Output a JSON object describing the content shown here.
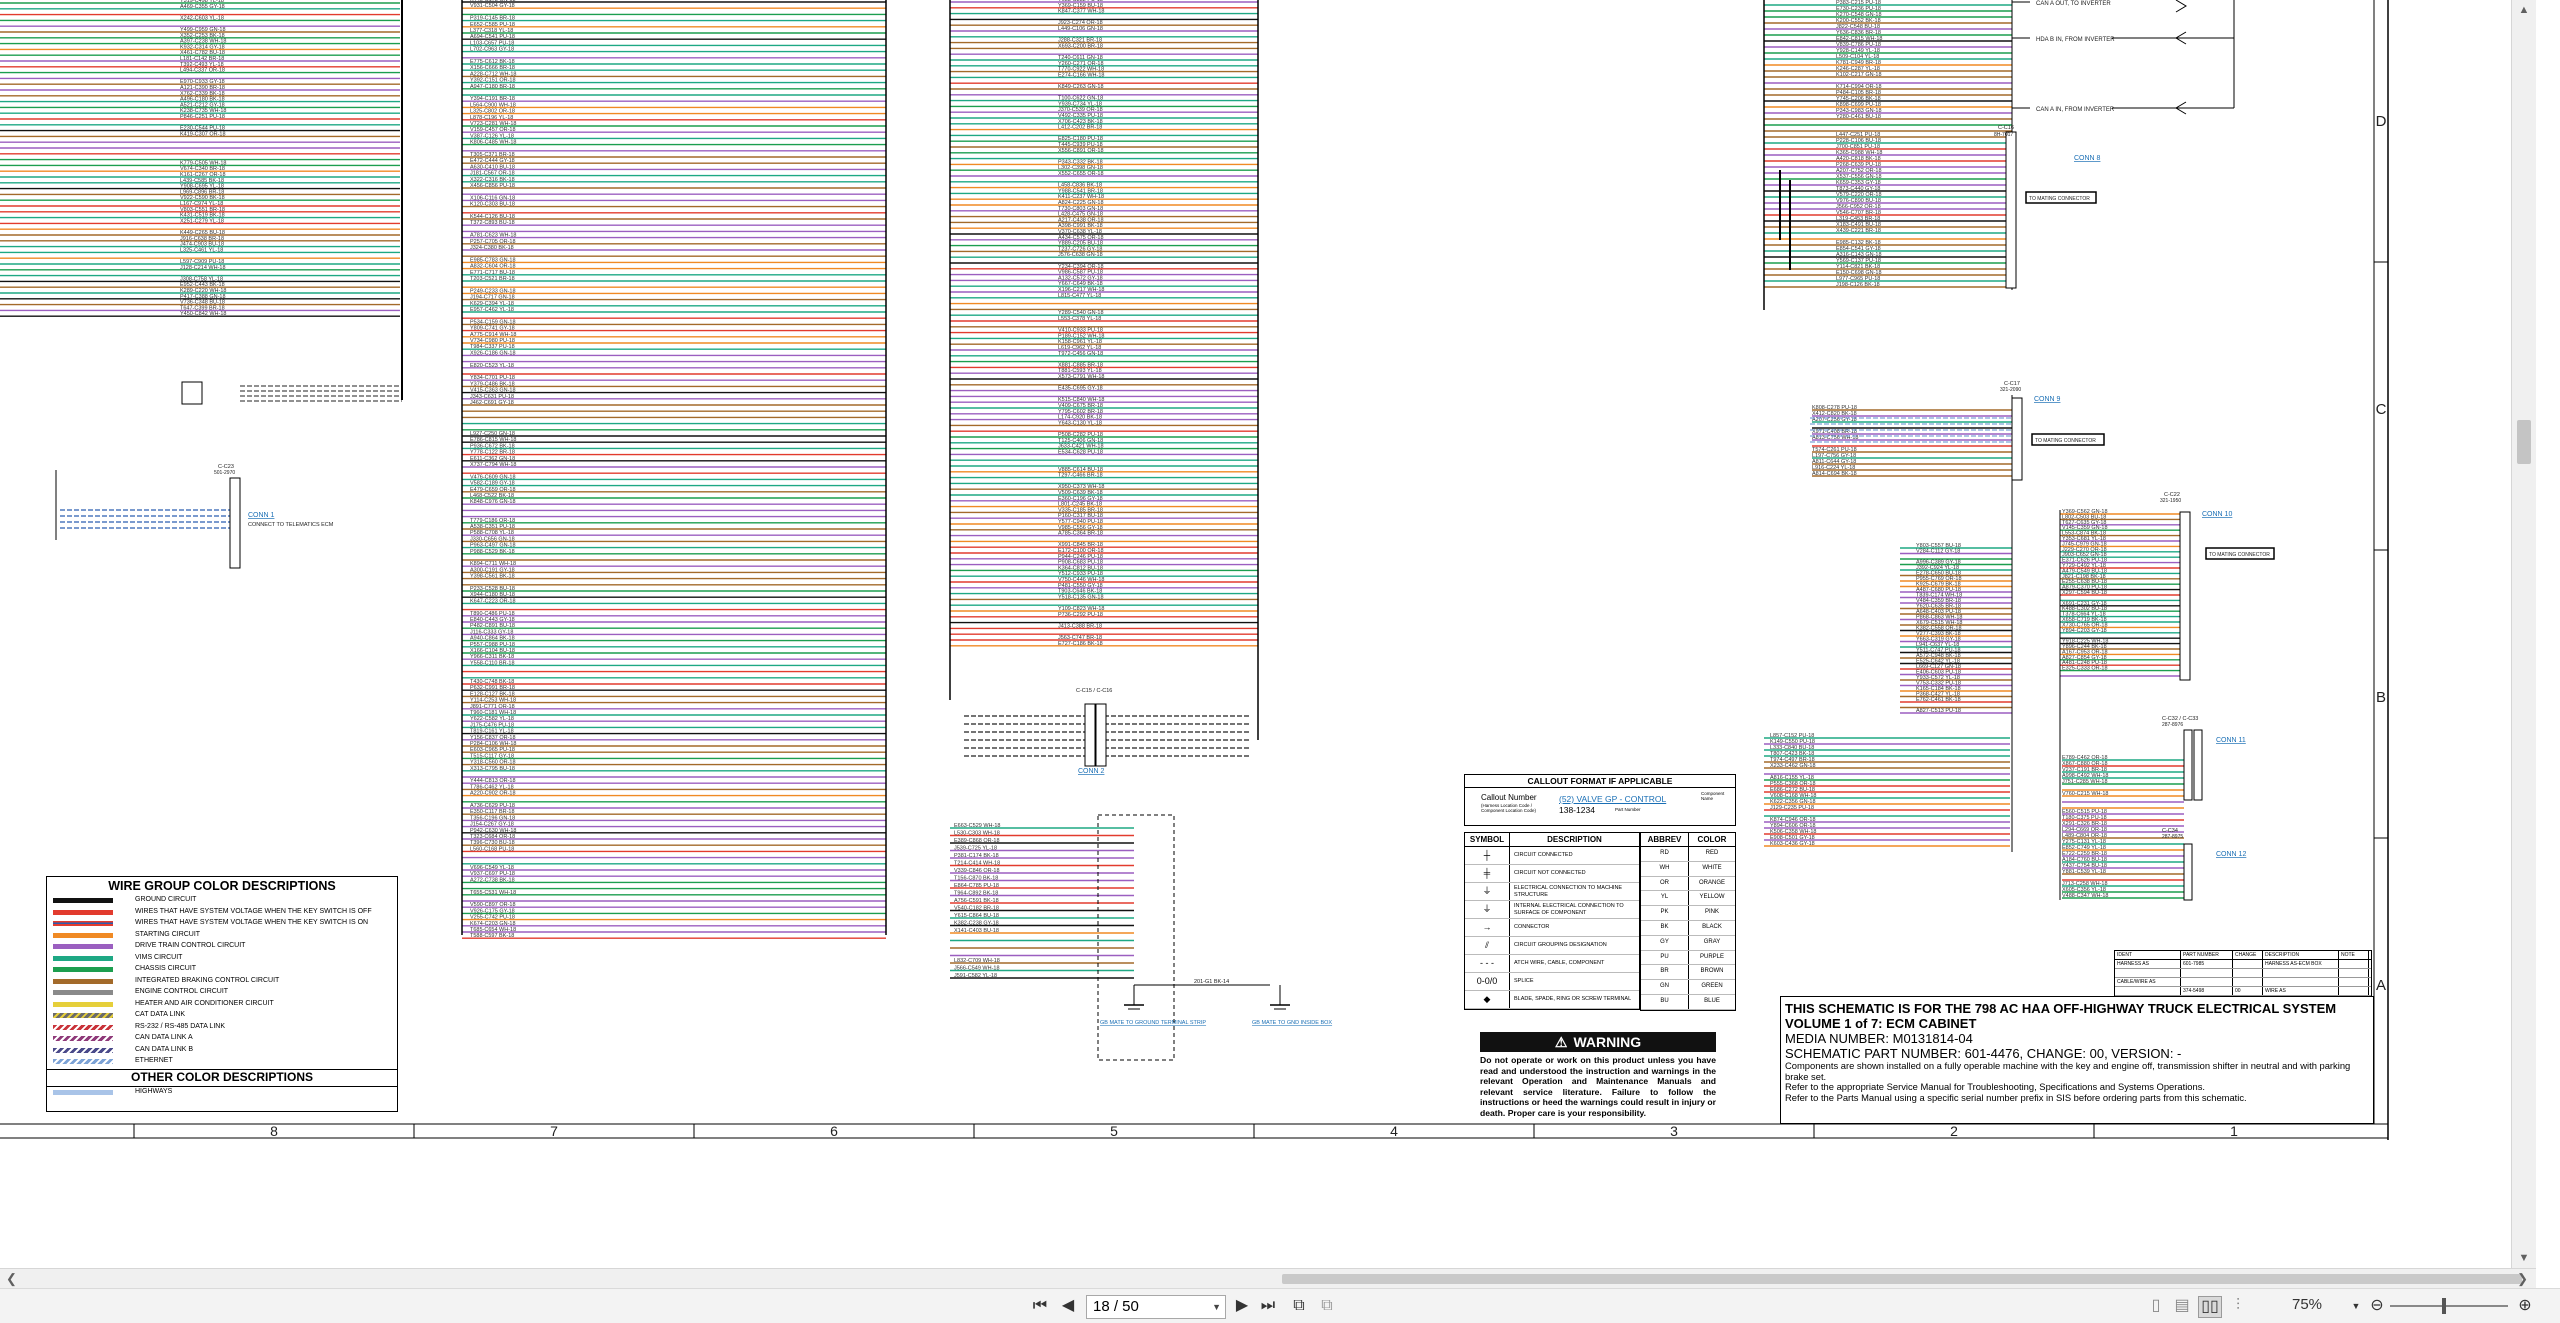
{
  "sheet": {
    "zone_letters": [
      "D",
      "C",
      "B",
      "A"
    ],
    "column_numbers": [
      "8",
      "7",
      "6",
      "5",
      "4",
      "3",
      "2",
      "1"
    ],
    "connectors": {
      "conn1": {
        "label": "CONN 1",
        "desc": "CONNECT TO TELEMATICS ECM",
        "id": "C-C23",
        "part": "501-2970"
      },
      "conn2": {
        "label": "CONN 2",
        "id": "C-C15 / C-C16"
      },
      "conn8": {
        "label": "CONN 8",
        "id": "C-C16",
        "part": "8H-7017",
        "mating": "TO MATING CONNECTOR"
      },
      "conn9": {
        "label": "CONN 9",
        "id": "C-C17",
        "part": "321-2090",
        "mating": "TO MATING CONNECTOR"
      },
      "conn10": {
        "label": "CONN 10",
        "id": "C-C22",
        "part": "321-1950",
        "mating": "TO MATING CONNECTOR"
      },
      "conn11": {
        "label": "CONN 11",
        "id": "C-C32 / C-C33",
        "part": "287-8976"
      },
      "conn12": {
        "label": "CONN 12",
        "id": "C-C34",
        "part": "287-8975"
      }
    },
    "inverter_labels": [
      "CAN A OUT, TO INVERTER",
      "HDA B IN, FROM INVERTER",
      "CAN A IN, FROM INVERTER"
    ],
    "ground_labels": [
      "GB MATE TO GROUND TERMINAL STRIP",
      "GB MATE TO GND INSIDE BOX"
    ],
    "ground_wire": "201-G1 BK-14",
    "wire_group_legend": {
      "title": "WIRE GROUP COLOR DESCRIPTIONS",
      "items": [
        {
          "label": "GROUND CIRCUIT",
          "color": "#111111",
          "pattern": "solid"
        },
        {
          "label": "WIRES THAT HAVE SYSTEM VOLTAGE WHEN THE KEY SWITCH IS OFF",
          "color": "#e23b2e",
          "pattern": "solid"
        },
        {
          "label": "WIRES THAT HAVE SYSTEM VOLTAGE WHEN THE KEY SWITCH IS ON",
          "color": "#e23b2e",
          "pattern": "blue-stripe"
        },
        {
          "label": "STARTING CIRCUIT",
          "color": "#f08a24",
          "pattern": "solid"
        },
        {
          "label": "DRIVE TRAIN CONTROL CIRCUIT",
          "color": "#9b5fc0",
          "pattern": "solid"
        },
        {
          "label": "VIMS CIRCUIT",
          "color": "#1ea884",
          "pattern": "solid"
        },
        {
          "label": "CHASSIS CIRCUIT",
          "color": "#1c9e4f",
          "pattern": "solid"
        },
        {
          "label": "INTEGRATED BRAKING CONTROL CIRCUIT",
          "color": "#a36a2a",
          "pattern": "solid"
        },
        {
          "label": "ENGINE CONTROL CIRCUIT",
          "color": "#8a8a8a",
          "pattern": "solid"
        },
        {
          "label": "HEATER AND AIR CONDITIONER CIRCUIT",
          "color": "#e6cf3a",
          "pattern": "solid"
        },
        {
          "label": "CAT DATA LINK",
          "color": "#6b6b6b",
          "pattern": "hatch-yellow"
        },
        {
          "label": "RS-232 / RS-485 DATA LINK",
          "color": "#c9333a",
          "pattern": "hatch"
        },
        {
          "label": "CAN DATA LINK A",
          "color": "#8f3a7a",
          "pattern": "hatch"
        },
        {
          "label": "CAN DATA LINK B",
          "color": "#4a4a8a",
          "pattern": "hatch"
        },
        {
          "label": "ETHERNET",
          "color": "#7da3d6",
          "pattern": "hatch"
        }
      ],
      "other_title": "OTHER COLOR DESCRIPTIONS",
      "other_items": [
        {
          "label": "HIGHWAYS",
          "color": "#a9c4e8"
        }
      ]
    },
    "callout": {
      "title": "CALLOUT FORMAT IF APPLICABLE",
      "callout_number": "Callout Number",
      "callout_sub": "(Harness Location Code / Component Location Code)",
      "component_name": "(52) VALVE GP - CONTROL",
      "part_number": "138-1234",
      "component_note": "Component Name",
      "part_note": "Part Number"
    },
    "symbol_table": {
      "headers": [
        "SYMBOL",
        "DESCRIPTION"
      ],
      "rows": [
        {
          "sym": "┼",
          "desc": "CIRCUIT CONNECTED"
        },
        {
          "sym": "╪",
          "desc": "CIRCUIT NOT CONNECTED"
        },
        {
          "sym": "⏚",
          "desc": "ELECTRICAL CONNECTION TO MACHINE STRUCTURE"
        },
        {
          "sym": "⏚",
          "desc": "INTERNAL ELECTRICAL CONNECTION TO SURFACE OF COMPONENT"
        },
        {
          "sym": "→",
          "desc": "CONNECTOR"
        },
        {
          "sym": "⫽",
          "desc": "CIRCUIT GROUPING DESIGNATION"
        },
        {
          "sym": "- - -",
          "desc": "ATCH WIRE, CABLE, COMPONENT"
        },
        {
          "sym": "0-0/0",
          "desc": "SPLICE"
        },
        {
          "sym": "◆",
          "desc": "BLADE, SPADE, RING OR SCREW TERMINAL"
        }
      ]
    },
    "abbrev_table": {
      "headers": [
        "ABBREV",
        "COLOR"
      ],
      "rows": [
        [
          "RD",
          "RED"
        ],
        [
          "WH",
          "WHITE"
        ],
        [
          "OR",
          "ORANGE"
        ],
        [
          "YL",
          "YELLOW"
        ],
        [
          "PK",
          "PINK"
        ],
        [
          "BK",
          "BLACK"
        ],
        [
          "GY",
          "GRAY"
        ],
        [
          "PU",
          "PURPLE"
        ],
        [
          "BR",
          "BROWN"
        ],
        [
          "GN",
          "GREEN"
        ],
        [
          "BU",
          "BLUE"
        ]
      ]
    },
    "warning": {
      "title": "WARNING",
      "text": "Do not operate or work on this product unless you have read and understood the instruction and warnings in the relevant Operation and Maintenance Manuals and relevant service literature. Failure to follow the instructions or heed the warnings could result in injury or death. Proper care is your responsibility."
    },
    "title_block": {
      "line1": "THIS SCHEMATIC IS FOR THE 798 AC HAA OFF-HIGHWAY TRUCK ELECTRICAL SYSTEM",
      "line2": "VOLUME 1 of 7: ECM CABINET",
      "media": "MEDIA NUMBER: M0131814-04",
      "part": "SCHEMATIC PART NUMBER: 601-4476, CHANGE: 00, VERSION: -",
      "note1": "Components are shown installed on a fully operable machine with the key and engine off, transmission shifter in neutral and with parking brake set.",
      "note2": "Refer to the appropriate Service Manual for Troubleshooting, Specifications and Systems Operations.",
      "note3": "Refer to the Parts Manual using a specific serial number prefix in SIS before ordering parts from this schematic."
    },
    "revision_table": {
      "headers": [
        "IDENT",
        "PART NUMBER",
        "CHANGE",
        "DESCRIPTION",
        "NOTE"
      ],
      "rows": [
        [
          "HARNESS AS",
          "601-7985",
          "",
          "HARNESS AS-ECM BOX",
          ""
        ],
        [
          "",
          "",
          "",
          "",
          ""
        ],
        [
          "CABLE/WIRE AS",
          "",
          "",
          "",
          ""
        ],
        [
          "",
          "374-5498",
          "00",
          "WIRE AS",
          ""
        ]
      ]
    }
  },
  "toolbar": {
    "page_text": "18 / 50",
    "zoom": "75%",
    "icons": [
      "first-page-icon",
      "prev-page-icon",
      "next-page-icon",
      "last-page-icon",
      "fit-width-icon",
      "fit-page-icon",
      "single-page-icon",
      "continuous-icon",
      "facing-icon",
      "split-icon",
      "zoom-out-icon",
      "zoom-in-icon"
    ]
  }
}
